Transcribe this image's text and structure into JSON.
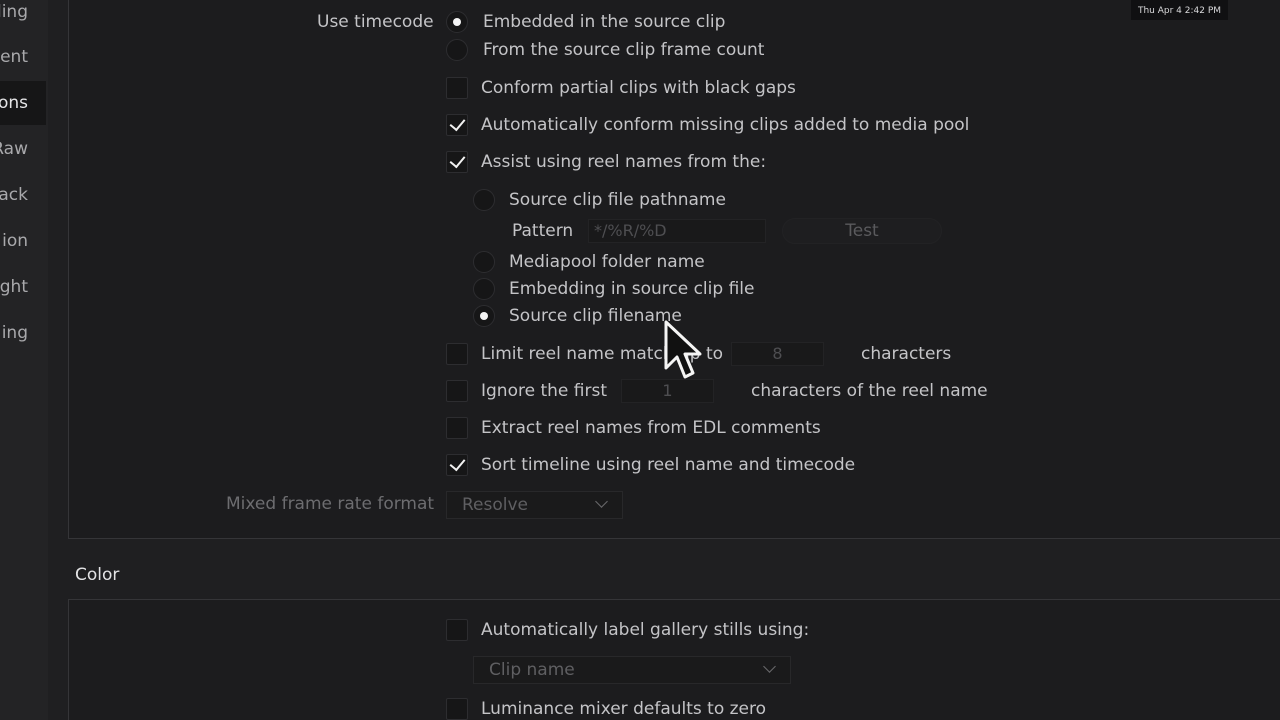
{
  "sidebar": {
    "items": [
      {
        "label": "ling"
      },
      {
        "label": "ent"
      },
      {
        "label": "ons"
      },
      {
        "label": "Raw"
      },
      {
        "label": "ack"
      },
      {
        "label": "ion"
      },
      {
        "label": "ght"
      },
      {
        "label": "ing"
      }
    ]
  },
  "clock": "Thu Apr 4  2:42 PM",
  "conform": {
    "use_timecode_label": "Use timecode",
    "timecode_options": [
      {
        "label": "Embedded in the source clip",
        "selected": true
      },
      {
        "label": "From the source clip frame count",
        "selected": false
      }
    ],
    "conform_partial": {
      "label": "Conform partial clips with black gaps",
      "checked": false
    },
    "auto_conform": {
      "label": "Automatically conform missing clips added to media pool",
      "checked": true
    },
    "assist_reel": {
      "label": "Assist using reel names from the:",
      "checked": true
    },
    "reel_sources": [
      {
        "label": "Source clip file pathname",
        "selected": false
      },
      {
        "label": "Mediapool folder name",
        "selected": false
      },
      {
        "label": "Embedding in source clip file",
        "selected": false
      },
      {
        "label": "Source clip filename",
        "selected": true
      }
    ],
    "pattern_label": "Pattern",
    "pattern_value": "*/%R/%D",
    "test_label": "Test",
    "limit_reel": {
      "label": "Limit reel name match up to",
      "checked": false,
      "value": "8",
      "suffix": "characters"
    },
    "ignore_first": {
      "label": "Ignore the first",
      "checked": false,
      "value": "1",
      "suffix": "characters of the reel name"
    },
    "extract_edl": {
      "label": "Extract reel names from EDL comments",
      "checked": false
    },
    "sort_timeline": {
      "label": "Sort timeline using reel name and timecode",
      "checked": true
    },
    "mixed_frame_label": "Mixed frame rate format",
    "mixed_frame_value": "Resolve"
  },
  "color": {
    "title": "Color",
    "auto_label": {
      "label": "Automatically label gallery stills using:",
      "checked": false
    },
    "label_source": "Clip name",
    "luminance_mixer": {
      "label": "Luminance mixer defaults to zero",
      "checked": false
    }
  }
}
